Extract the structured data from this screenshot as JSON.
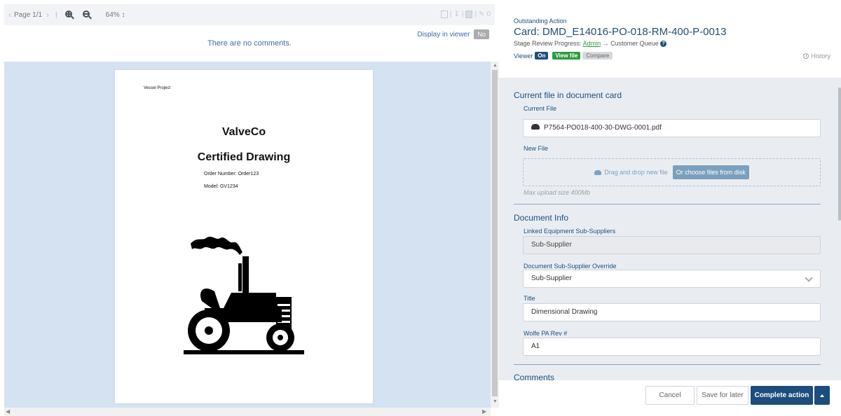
{
  "toolbar": {
    "page_label": "Page 1/1",
    "zoom_level": "64% ↕",
    "comment_count": "0",
    "icons": [
      "chevron-left-icon",
      "chevron-right-icon",
      "zoom-in-icon",
      "zoom-out-icon",
      "screen-icon",
      "download-icon",
      "stop-icon",
      "edit-icon"
    ]
  },
  "viewer": {
    "display_in_viewer_label": "Display in viewer",
    "display_in_viewer_value": "No",
    "no_comments": "There are no comments."
  },
  "document_page": {
    "project": "Vessel Project",
    "vendor": "ValveCo",
    "title": "Certified Drawing",
    "order_number": "Order Number: Order123",
    "model": "Model: GV1234"
  },
  "header": {
    "pretitle": "Outstanding Action",
    "card_title": "Card: DMD_E14016-PO-018-RM-400-P-0013",
    "stage_label": "Stage Review Progress:",
    "stage_link": "Admin",
    "stage_arrow": "→",
    "stage_next": "Customer Queue",
    "viewer_label": "Viewer",
    "viewer_on": "On",
    "view_file": "View file",
    "compare": "Compare",
    "history": "History"
  },
  "form": {
    "current_file_section": "Current file in document card",
    "current_file_label": "Current File",
    "current_file_value": "P7564-PO018-400-30-DWG-0001.pdf",
    "new_file_label": "New File",
    "drag_drop": "Drag and drop new file",
    "choose_files": "Or choose files from disk",
    "max_upload": "Max upload size 400Mb",
    "document_info_section": "Document Info",
    "linked_label": "Linked Equipment Sub-Suppliers",
    "linked_value": "Sub-Supplier",
    "override_label": "Document Sub-Supplier Override",
    "override_value": "Sub-Supplier",
    "title_label": "Title",
    "title_value": "Dimensional Drawing",
    "rev_label": "Wolfe PA Rev #",
    "rev_value": "A1",
    "comments_section": "Comments"
  },
  "footer": {
    "cancel": "Cancel",
    "save": "Save for later",
    "complete": "Complete action"
  },
  "colors": {
    "accent": "#1f4e7a",
    "success": "#2d9b3e",
    "viewer_bg": "#d5e2f1",
    "form_bg": "#e9edf2"
  }
}
